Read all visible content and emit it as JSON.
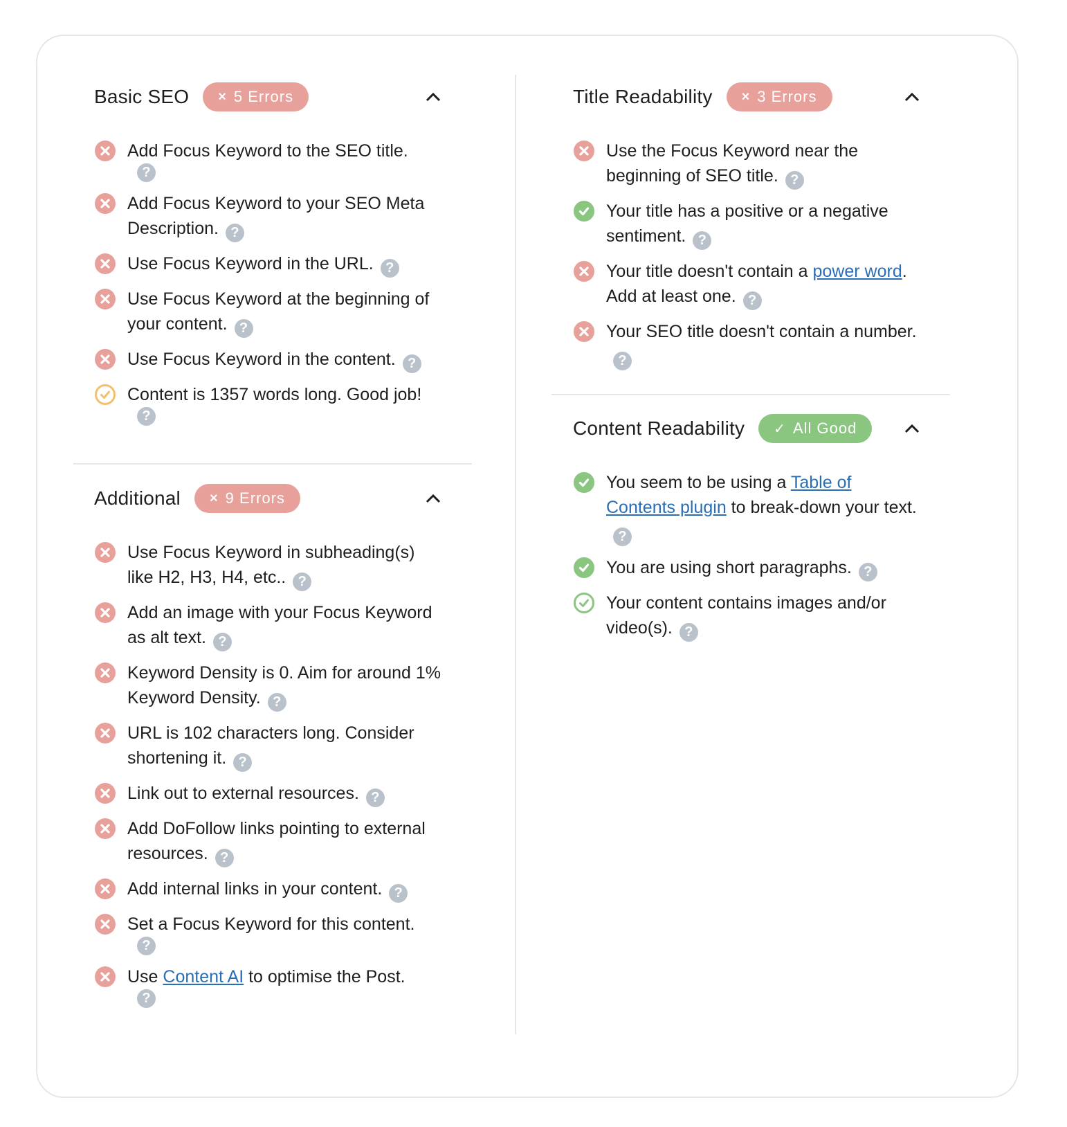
{
  "colors": {
    "error": "#e8a09b",
    "good": "#8bc680",
    "warning": "#f5be6b",
    "help": "#b9c1cb",
    "link": "#2a6eb6"
  },
  "sections": {
    "basic_seo": {
      "title": "Basic SEO",
      "badge": {
        "type": "error",
        "icon": "×",
        "label": "5 Errors"
      },
      "items": [
        {
          "status": "error",
          "text": "Add Focus Keyword to the SEO title."
        },
        {
          "status": "error",
          "text": "Add Focus Keyword to your SEO Meta Description."
        },
        {
          "status": "error",
          "text": "Use Focus Keyword in the URL."
        },
        {
          "status": "error",
          "text": "Use Focus Keyword at the beginning of your content."
        },
        {
          "status": "error",
          "text": "Use Focus Keyword in the content."
        },
        {
          "status": "warning",
          "text": "Content is 1357 words long. Good job!"
        }
      ]
    },
    "additional": {
      "title": "Additional",
      "badge": {
        "type": "error",
        "icon": "×",
        "label": "9 Errors"
      },
      "items": [
        {
          "status": "error",
          "text": "Use Focus Keyword in subheading(s) like H2, H3, H4, etc.."
        },
        {
          "status": "error",
          "text": "Add an image with your Focus Keyword as alt text."
        },
        {
          "status": "error",
          "text": "Keyword Density is 0. Aim for around 1% Keyword Density."
        },
        {
          "status": "error",
          "text": "URL is 102 characters long. Consider shortening it."
        },
        {
          "status": "error",
          "text": "Link out to external resources."
        },
        {
          "status": "error",
          "text": "Add DoFollow links pointing to external resources."
        },
        {
          "status": "error",
          "text": "Add internal links in your content."
        },
        {
          "status": "error",
          "text": "Set a Focus Keyword for this content."
        },
        {
          "status": "error",
          "before": "Use ",
          "link": "Content AI",
          "after": " to optimise the Post."
        }
      ]
    },
    "title_readability": {
      "title": "Title Readability",
      "badge": {
        "type": "error",
        "icon": "×",
        "label": "3 Errors"
      },
      "items": [
        {
          "status": "error",
          "text": "Use the Focus Keyword near the beginning of SEO title."
        },
        {
          "status": "good",
          "text": "Your title has a positive or a negative sentiment."
        },
        {
          "status": "error",
          "before": "Your title doesn't contain a ",
          "link": "power word",
          "after": ". Add at least one."
        },
        {
          "status": "error",
          "text": "Your SEO title doesn't contain a number."
        }
      ]
    },
    "content_readability": {
      "title": "Content Readability",
      "badge": {
        "type": "good",
        "icon": "✓",
        "label": "All Good"
      },
      "items": [
        {
          "status": "good",
          "before": "You seem to be using a ",
          "link": "Table of Contents plugin",
          "after": " to break-down your text."
        },
        {
          "status": "good",
          "text": "You are using short paragraphs."
        },
        {
          "status": "good-outline",
          "text": "Your content contains images and/or video(s)."
        }
      ]
    }
  },
  "help_glyph": "?"
}
